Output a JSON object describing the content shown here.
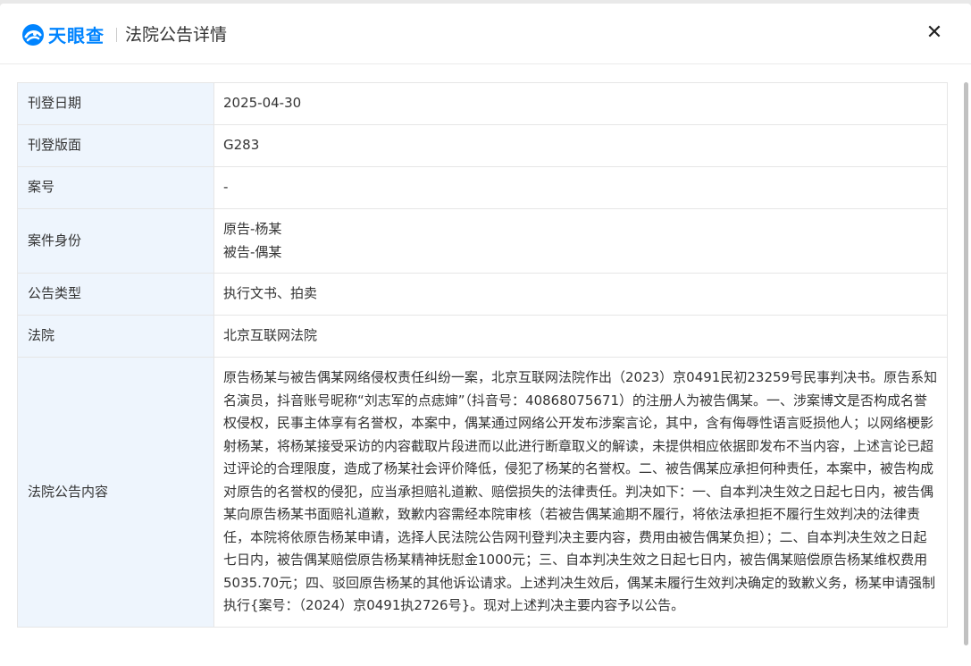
{
  "header": {
    "logo_text": "天眼查",
    "title": "法院公告详情",
    "close": "✕"
  },
  "rows": [
    {
      "label": "刊登日期",
      "value": "2025-04-30"
    },
    {
      "label": "刊登版面",
      "value": "G283"
    },
    {
      "label": "案号",
      "value": "-"
    },
    {
      "label": "案件身份",
      "value_lines": [
        "原告-杨某",
        "被告-偶某"
      ]
    },
    {
      "label": "公告类型",
      "value": "执行文书、拍卖"
    },
    {
      "label": "法院",
      "value": "北京互联网法院"
    },
    {
      "label": "法院公告内容",
      "value": "原告杨某与被告偶某网络侵权责任纠纷一案，北京互联网法院作出（2023）京0491民初23259号民事判决书。原告系知名演员，抖音账号昵称“刘志军的点痣婶”（抖音号：40868075671）的注册人为被告偶某。一、涉案博文是否构成名誉权侵权，民事主体享有名誉权，本案中，偶某通过网络公开发布涉案言论，其中，含有侮辱性语言贬损他人；以网络梗影射杨某，将杨某接受采访的内容截取片段进而以此进行断章取义的解读，未提供相应依据即发布不当内容，上述言论已超过评论的合理限度，造成了杨某社会评价降低，侵犯了杨某的名誉权。二、被告偶某应承担何种责任，本案中，被告构成对原告的名誉权的侵犯，应当承担赔礼道歉、赔偿损失的法律责任。判决如下：一、自本判决生效之日起七日内，被告偶某向原告杨某书面赔礼道歉，致歉内容需经本院审核（若被告偶某逾期不履行，将依法承担拒不履行生效判决的法律责任，本院将依原告杨某申请，选择人民法院公告网刊登判决主要内容，费用由被告偶某负担）；二、自本判决生效之日起七日内，被告偶某赔偿原告杨某精神抚慰金1000元；三、自本判决生效之日起七日内，被告偶某赔偿原告杨某维权费用5035.70元；四、驳回原告杨某的其他诉讼请求。上述判决生效后，偶某未履行生效判决确定的致歉义务，杨某申请强制执行{案号：（2024）京0491执2726号}。现对上述判决主要内容予以公告。"
    }
  ],
  "colors": {
    "brand": "#0084ff",
    "label_bg": "#eef5fd"
  }
}
